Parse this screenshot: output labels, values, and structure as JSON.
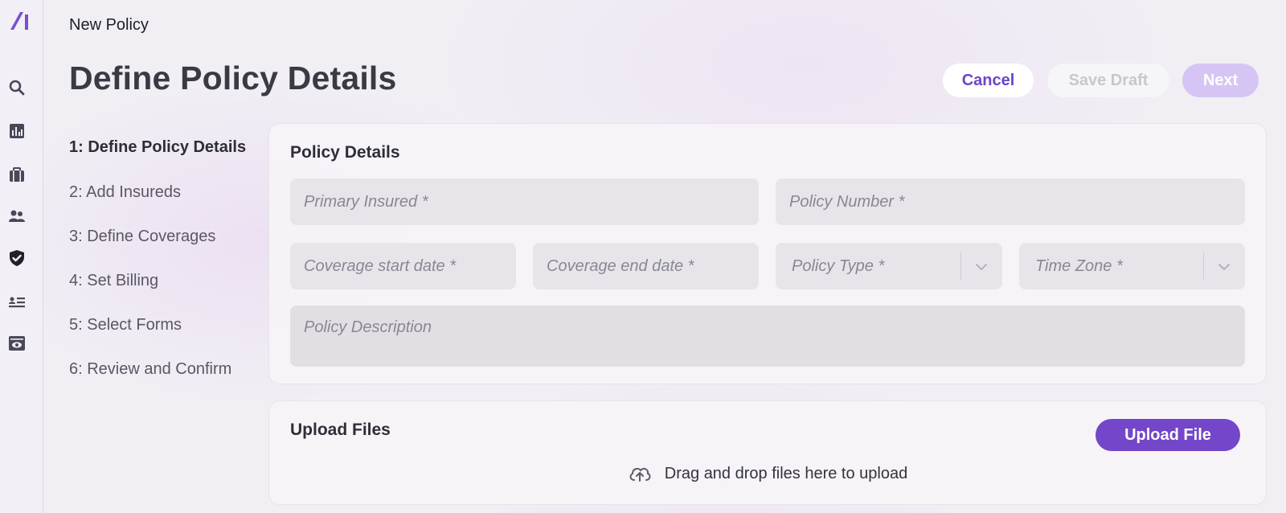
{
  "header": {
    "breadcrumb": "New Policy",
    "title": "Define Policy Details",
    "actions": {
      "cancel": "Cancel",
      "save_draft": "Save Draft",
      "next": "Next"
    }
  },
  "nav": {
    "icons": [
      "logo-icon",
      "search-icon",
      "chart-icon",
      "briefcase-icon",
      "users-icon",
      "shield-check-icon",
      "contact-list-icon",
      "eye-card-icon"
    ]
  },
  "steps": [
    {
      "label": "1: Define Policy Details",
      "active": true
    },
    {
      "label": "2: Add Insureds",
      "active": false
    },
    {
      "label": "3: Define Coverages",
      "active": false
    },
    {
      "label": "4: Set Billing",
      "active": false
    },
    {
      "label": "5: Select Forms",
      "active": false
    },
    {
      "label": "6: Review and Confirm",
      "active": false
    }
  ],
  "policy_details": {
    "title": "Policy Details",
    "fields": {
      "primary_insured": "Primary Insured *",
      "policy_number": "Policy Number *",
      "coverage_start": "Coverage start date *",
      "coverage_end": "Coverage end date *",
      "policy_type": "Policy Type *",
      "time_zone": "Time Zone *",
      "description": "Policy Description"
    }
  },
  "upload": {
    "title": "Upload Files",
    "button": "Upload File",
    "hint": "Drag and drop files here to upload"
  },
  "colors": {
    "accent": "#7446c9",
    "cancel_text": "#6c45c5",
    "next_disabled": "#d6c5f4"
  }
}
